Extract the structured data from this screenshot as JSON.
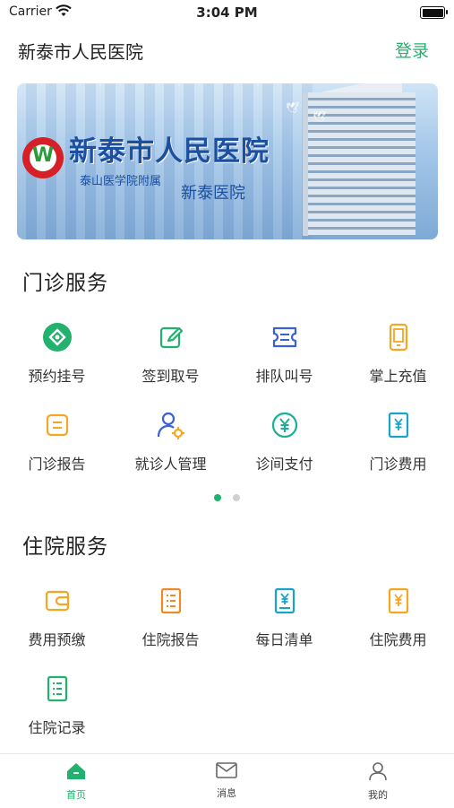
{
  "status_bar": {
    "carrier": "Carrier",
    "time": "3:04 PM"
  },
  "header": {
    "title": "新泰市人民医院",
    "login": "登录"
  },
  "banner": {
    "name": "新泰市人民医院",
    "sub1": "泰山医学院附属",
    "sub2": "新泰医院"
  },
  "outpatient": {
    "title": "门诊服务",
    "items": [
      {
        "label": "预约挂号",
        "icon": "appointment-icon"
      },
      {
        "label": "签到取号",
        "icon": "checkin-icon"
      },
      {
        "label": "排队叫号",
        "icon": "queue-ticket-icon"
      },
      {
        "label": "掌上充值",
        "icon": "mobile-recharge-icon"
      },
      {
        "label": "门诊报告",
        "icon": "report-icon"
      },
      {
        "label": "就诊人管理",
        "icon": "patient-settings-icon"
      },
      {
        "label": "诊间支付",
        "icon": "yuan-coin-icon"
      },
      {
        "label": "门诊费用",
        "icon": "yuan-document-icon"
      }
    ]
  },
  "pager": {
    "active_color": "#23b26d",
    "inactive_color": "#d0d0d0"
  },
  "inpatient": {
    "title": "住院服务",
    "items": [
      {
        "label": "费用预缴",
        "icon": "wallet-icon"
      },
      {
        "label": "住院报告",
        "icon": "list-report-icon"
      },
      {
        "label": "每日清单",
        "icon": "daily-bill-icon"
      },
      {
        "label": "住院费用",
        "icon": "yuan-document-icon"
      },
      {
        "label": "住院记录",
        "icon": "record-list-icon"
      }
    ]
  },
  "tabbar": {
    "home": "首页",
    "messages": "消息",
    "mine": "我的",
    "active_color": "#23b26d"
  },
  "colors": {
    "green": "#23b26d",
    "orange": "#f5a623",
    "blue": "#3b5fd6",
    "teal": "#1aa3c9",
    "brand_text": "#1d4fa0"
  }
}
